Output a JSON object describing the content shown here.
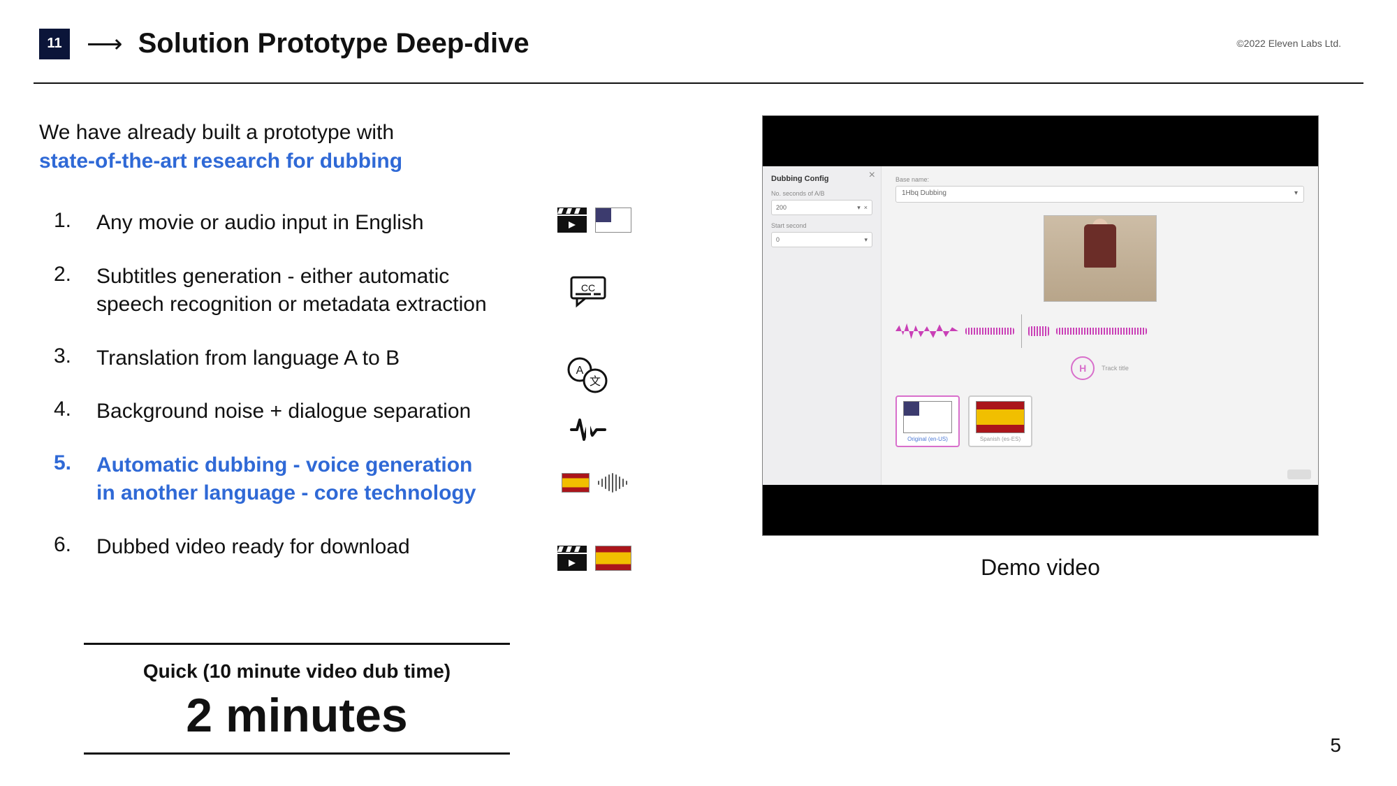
{
  "header": {
    "page_number_badge": "11",
    "arrow": "⟶",
    "title": "Solution Prototype Deep-dive",
    "copyright": "©2022 Eleven Labs Ltd."
  },
  "intro": {
    "line1": "We have already built a prototype with",
    "line2_highlight": "state-of-the-art research for dubbing"
  },
  "list": [
    {
      "n": "1.",
      "text": "Any movie or audio input in English",
      "highlight": false,
      "icons": [
        "clapper",
        "flag-us"
      ]
    },
    {
      "n": "2.",
      "text": "Subtitles generation - either automatic speech recognition or metadata extraction",
      "highlight": false,
      "icons": [
        "cc"
      ]
    },
    {
      "n": "3.",
      "text": "Translation from language A to B",
      "highlight": false,
      "icons": [
        "translate"
      ]
    },
    {
      "n": "4.",
      "text": "Background noise + dialogue separation",
      "highlight": false,
      "icons": [
        "wave-split"
      ]
    },
    {
      "n": "5.",
      "text": "Automatic dubbing - voice generation in another language - core technology",
      "highlight": true,
      "icons": [
        "flag-es",
        "soundwave"
      ]
    },
    {
      "n": "6.",
      "text": "Dubbed video ready for download",
      "highlight": false,
      "icons": [
        "clapper",
        "flag-es"
      ]
    }
  ],
  "callout": {
    "label": "Quick  (10 minute video dub time)",
    "value": "2 minutes"
  },
  "demo": {
    "caption": "Demo video",
    "panel": {
      "config_title": "Dubbing Config",
      "label_seconds": "No. seconds of A/B",
      "value_seconds": "200",
      "label_start": "Start second",
      "value_start": "0",
      "label_basename": "Base name:",
      "value_basename": "1Hbq Dubbing",
      "avatar_initial": "H",
      "avatar_text": "Track title",
      "flag_caption_us": "Original (en-US)",
      "flag_caption_es": "Spanish (es-ES)"
    }
  },
  "footer": {
    "slide_number": "5"
  }
}
